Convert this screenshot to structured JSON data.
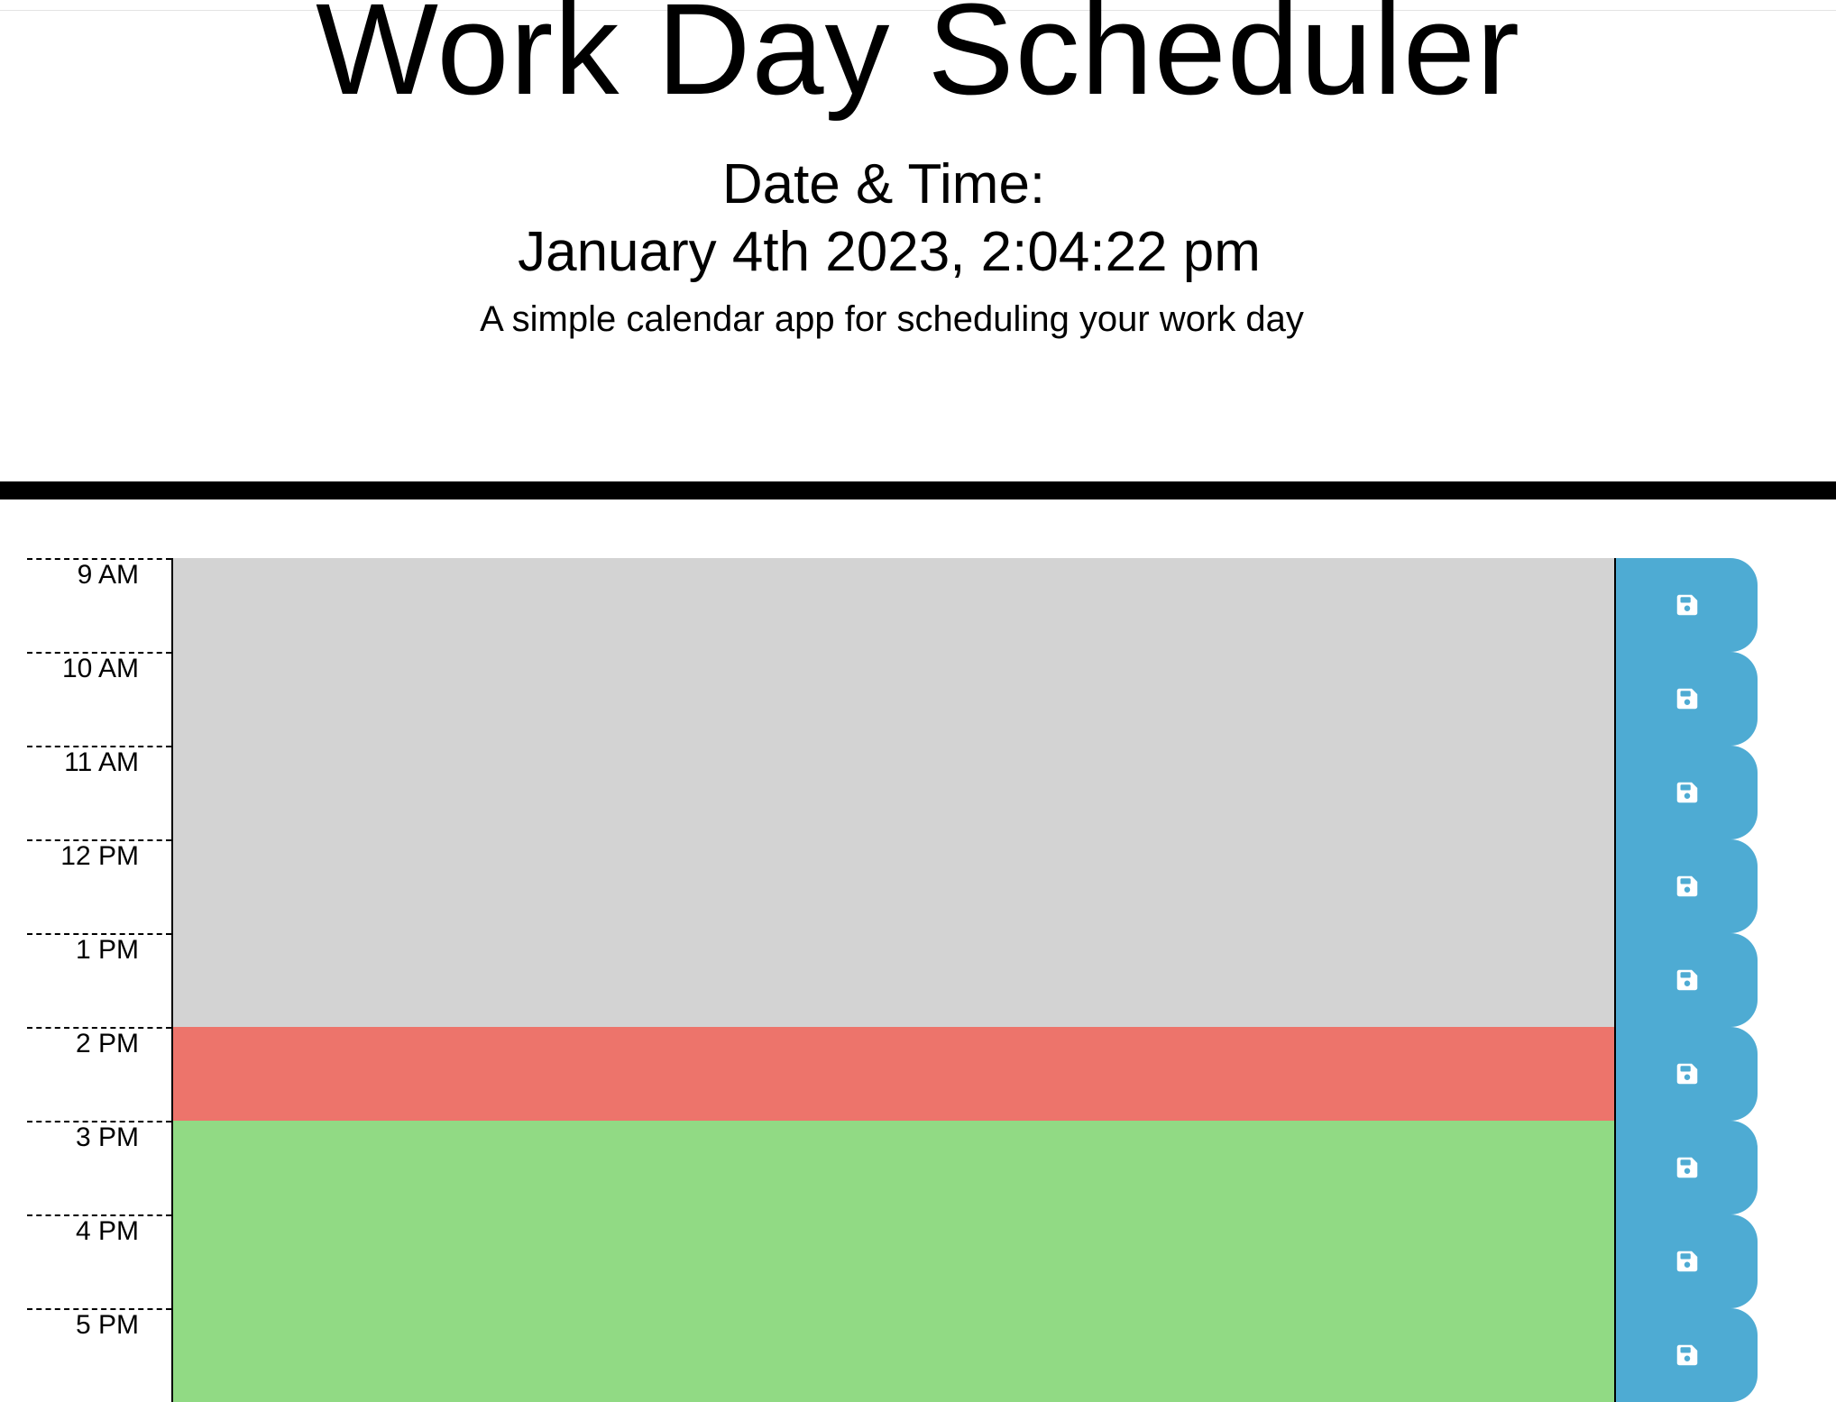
{
  "header": {
    "title": "Work Day Scheduler",
    "date_label": "Date & Time:",
    "date_value": "January 4th 2023, 2:04:22 pm",
    "lead": "A simple calendar app for scheduling your work day"
  },
  "colors": {
    "past": "#d3d3d3",
    "present": "#ed746b",
    "future": "#91da84",
    "save_button": "#4eabd3"
  },
  "schedule": {
    "save_icon": "save-icon",
    "hours": [
      {
        "label": "9 AM",
        "status": "past",
        "text": ""
      },
      {
        "label": "10 AM",
        "status": "past",
        "text": ""
      },
      {
        "label": "11 AM",
        "status": "past",
        "text": ""
      },
      {
        "label": "12 PM",
        "status": "past",
        "text": ""
      },
      {
        "label": "1 PM",
        "status": "past",
        "text": ""
      },
      {
        "label": "2 PM",
        "status": "present",
        "text": ""
      },
      {
        "label": "3 PM",
        "status": "future",
        "text": ""
      },
      {
        "label": "4 PM",
        "status": "future",
        "text": ""
      },
      {
        "label": "5 PM",
        "status": "future",
        "text": ""
      }
    ]
  }
}
